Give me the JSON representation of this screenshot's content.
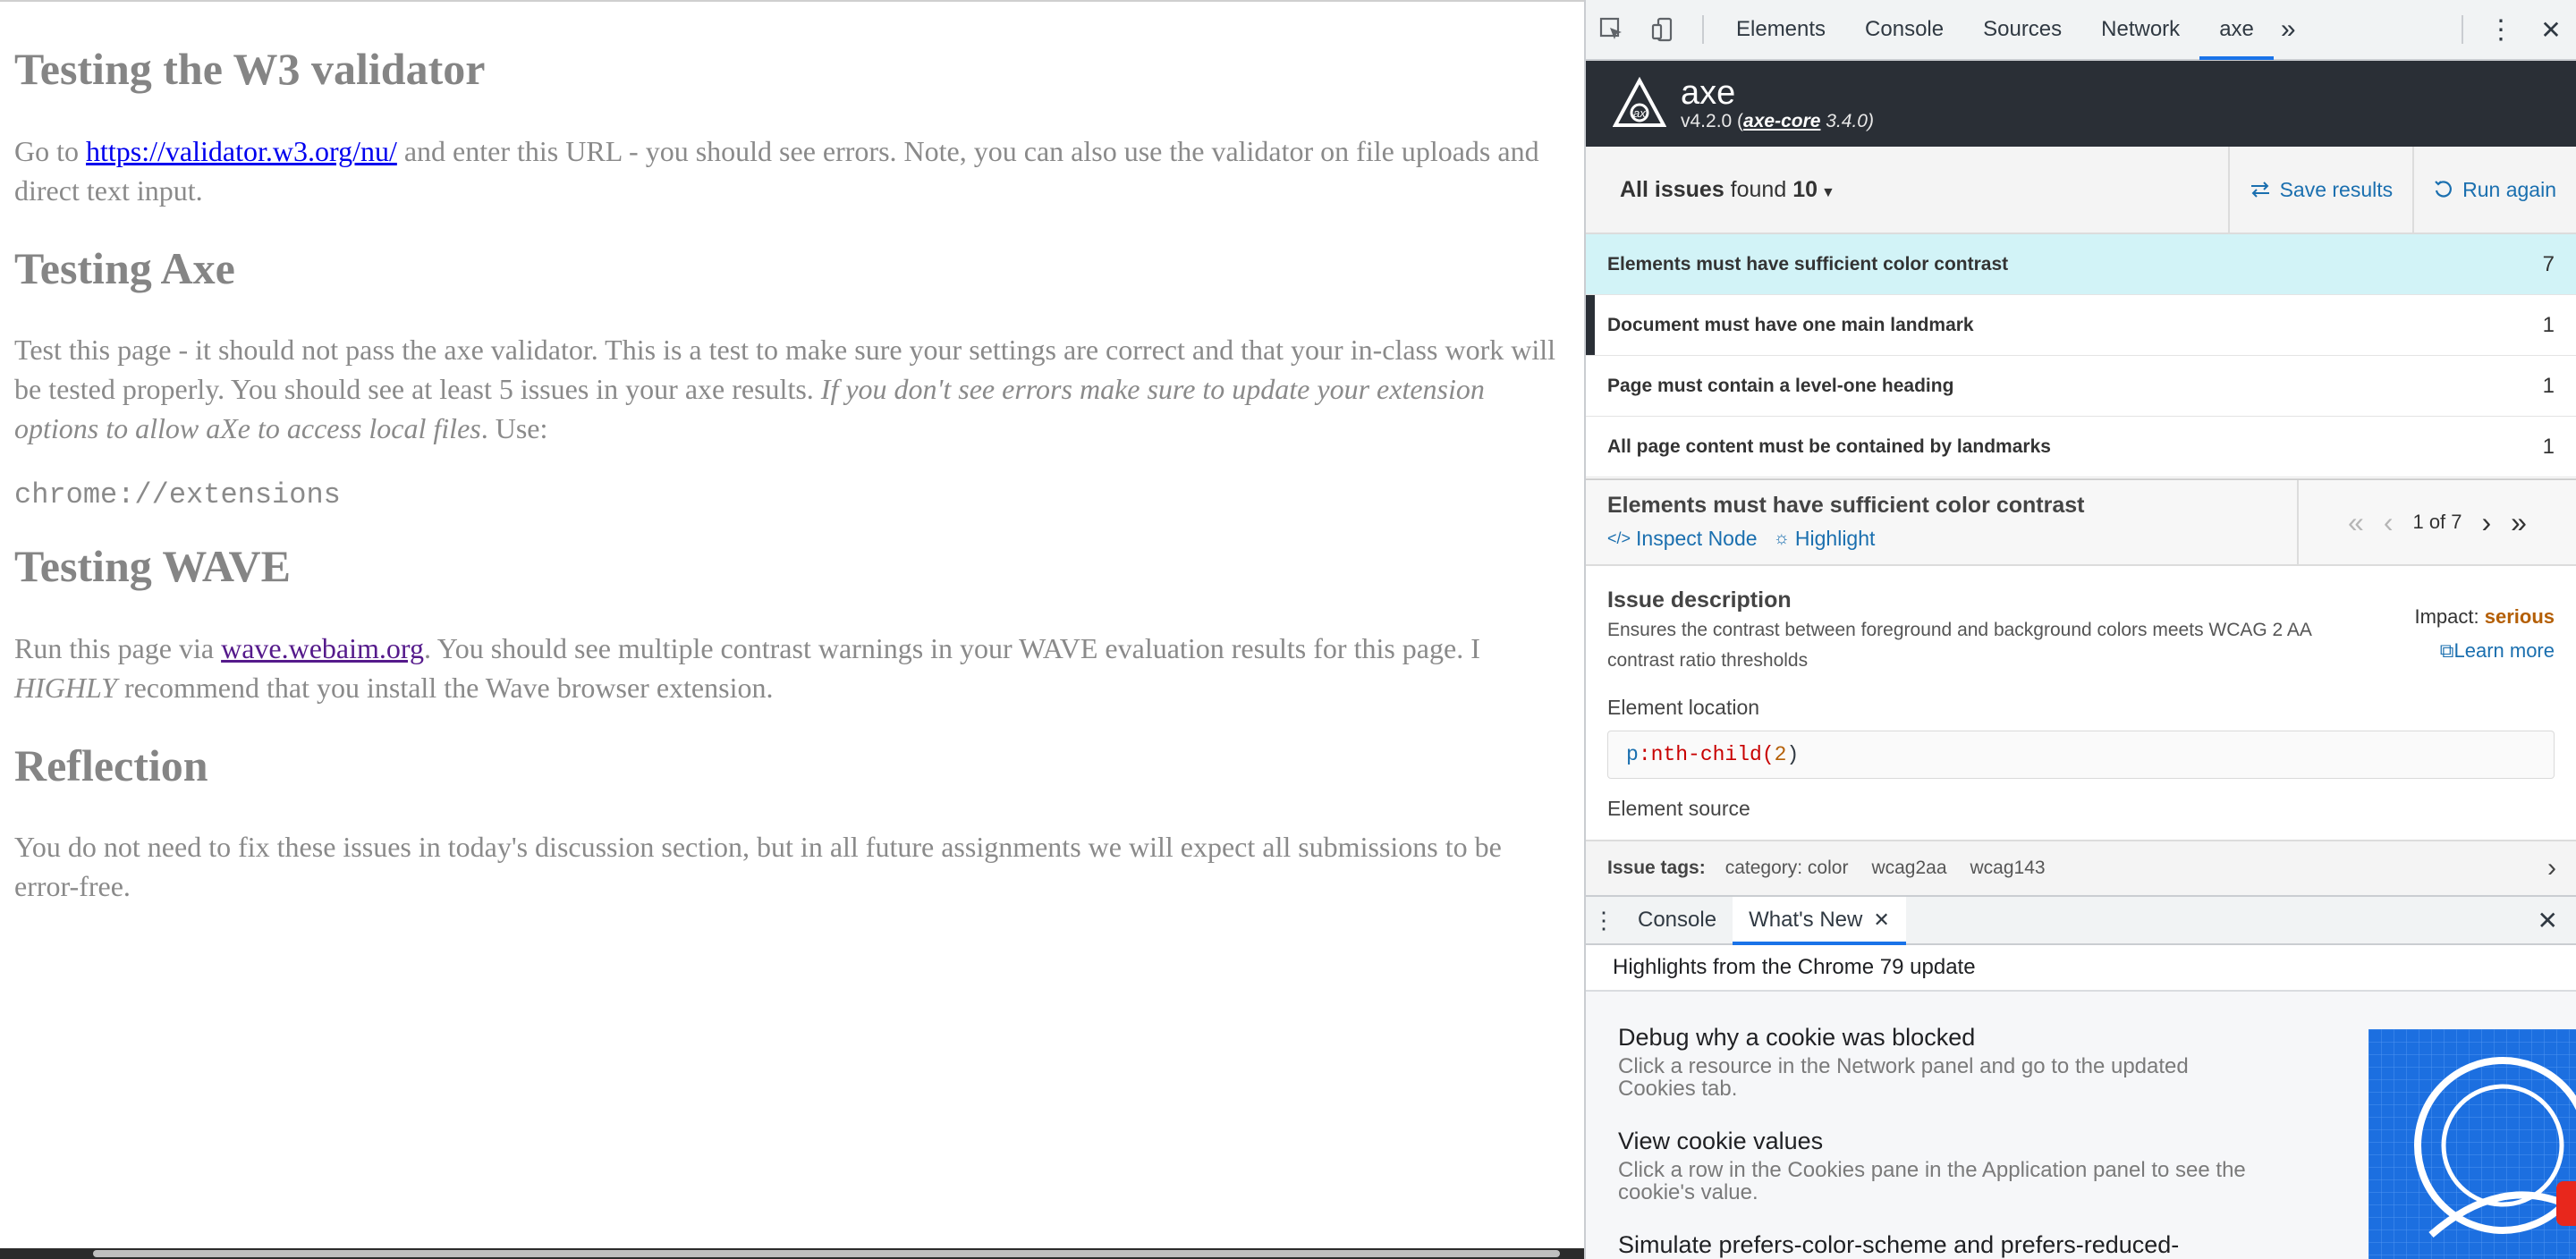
{
  "page": {
    "sections": [
      {
        "heading": "Testing the W3 validator"
      },
      {
        "heading": "Testing Axe"
      },
      {
        "heading": "Testing WAVE"
      },
      {
        "heading": "Reflection"
      }
    ],
    "w3_p_before": "Go to ",
    "w3_link": "https://validator.w3.org/nu/",
    "w3_p_after": " and enter this URL - you should see errors. Note, you can also use the validator on file uploads and direct text input.",
    "axe_p": "Test this page - it should not pass the axe validator. This is a test to make sure your settings are correct and that your in-class work will be tested properly. You should see at least 5 issues in your axe results. ",
    "axe_p_italic": "If you don't see errors make sure to update your extension options to allow aXe to access local files",
    "axe_p_end": ". Use:",
    "axe_code": "chrome://extensions",
    "wave_p_before": "Run this page via ",
    "wave_link": "wave.webaim.org",
    "wave_p_mid": ". You should see multiple contrast warnings in your WAVE evaluation results for this page. I ",
    "wave_p_italic": "HIGHLY",
    "wave_p_end": " recommend that you install the Wave browser extension.",
    "reflection_p": "You do not need to fix these issues in today's discussion section, but in all future assignments we will expect all submissions to be error-free."
  },
  "devtools": {
    "tabs": [
      "Elements",
      "Console",
      "Sources",
      "Network",
      "axe"
    ],
    "active_tab": "axe",
    "more": "»",
    "kebab": "⋮",
    "close": "✕",
    "axe": {
      "name": "axe",
      "version": "v4.2.0 (",
      "core_link": "axe-core",
      "core_version": " 3.4.0)"
    },
    "issues_bar": {
      "prefix": "All issues",
      "found": " found ",
      "count": "10",
      "save": "Save results",
      "run": "Run again"
    },
    "issues": [
      {
        "label": "Elements must have sufficient color contrast",
        "count": "7"
      },
      {
        "label": "Document must have one main landmark",
        "count": "1"
      },
      {
        "label": "Page must contain a level-one heading",
        "count": "1"
      },
      {
        "label": "All page content must be contained by landmarks",
        "count": "1"
      }
    ],
    "detail": {
      "title": "Elements must have sufficient color contrast",
      "inspect": "Inspect Node",
      "highlight": "Highlight",
      "pager": "1 of 7",
      "desc_heading": "Issue description",
      "desc": "Ensures the contrast between foreground and background colors meets WCAG 2 AA contrast ratio thresholds",
      "impact_label": "Impact: ",
      "impact_value": "serious",
      "learn_more": "Learn more",
      "location_label": "Element location",
      "code_sel": "p",
      "code_pseudo": ":nth-child(",
      "code_arg": "2",
      "code_end": ")",
      "source_label": "Element source"
    },
    "tags": {
      "label": "Issue tags:",
      "items": [
        "category: color",
        "wcag2aa",
        "wcag143"
      ]
    },
    "drawer": {
      "tabs": [
        "Console",
        "What's New"
      ],
      "active": "What's New",
      "heading": "Highlights from the Chrome 79 update",
      "items": [
        {
          "title": "Debug why a cookie was blocked",
          "desc": "Click a resource in the Network panel and go to the updated Cookies tab."
        },
        {
          "title": "View cookie values",
          "desc": "Click a row in the Cookies pane in the Application panel to see the cookie's value."
        },
        {
          "title": "Simulate prefers-color-scheme and prefers-reduced-",
          "desc": ""
        }
      ]
    }
  },
  "colors": {
    "axe_header_bg": "#2a2f36",
    "selected_row_bg": "#d2f3f7",
    "link_blue": "#1a6faf",
    "impact_serious": "#b45f06",
    "active_tab_underline": "#1a73e8"
  }
}
